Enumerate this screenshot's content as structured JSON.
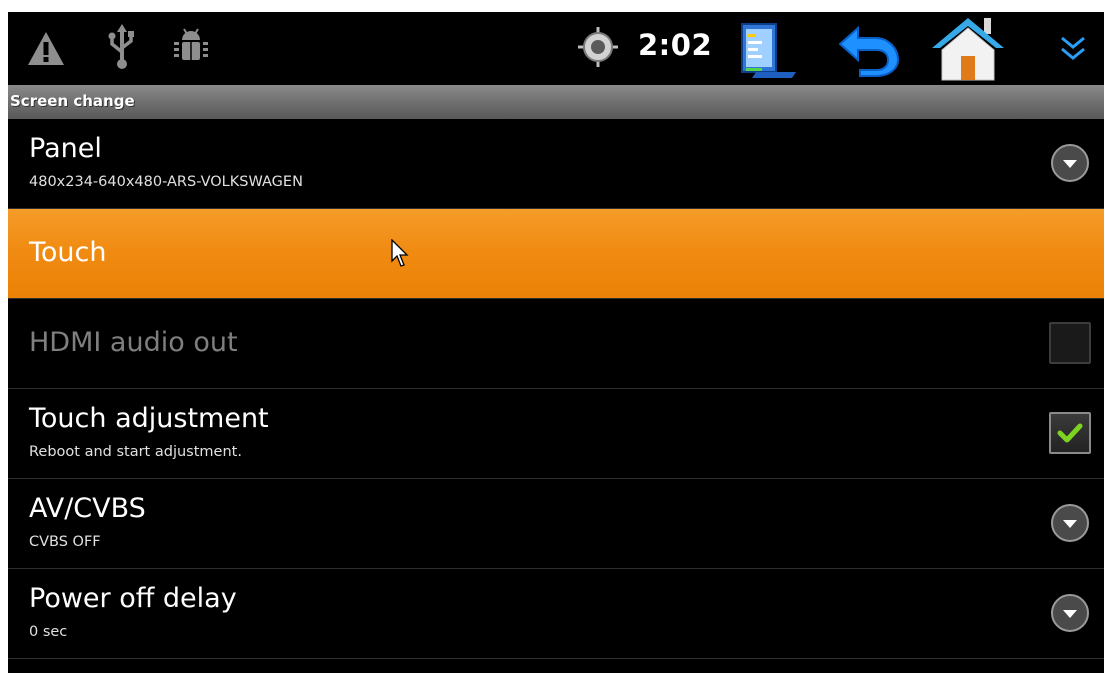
{
  "status_bar": {
    "time": "2:02",
    "icons": [
      "warning-icon",
      "usb-icon",
      "android-debug-icon",
      "gps-icon",
      "app-window-icon",
      "back-icon",
      "home-icon",
      "expand-icon"
    ]
  },
  "title_bar": {
    "title": "Screen change"
  },
  "settings": [
    {
      "title": "Panel",
      "subtitle": "480x234-640x480-ARS-VOLKSWAGEN",
      "control": "dropdown"
    },
    {
      "title": "Touch",
      "subtitle": "",
      "control": "none",
      "selected": true
    },
    {
      "title": "HDMI audio out",
      "subtitle": "",
      "control": "checkbox",
      "checked": false,
      "disabled": true
    },
    {
      "title": "Touch adjustment",
      "subtitle": "Reboot and start adjustment.",
      "control": "checkbox",
      "checked": true
    },
    {
      "title": "AV/CVBS",
      "subtitle": "CVBS OFF",
      "control": "dropdown"
    },
    {
      "title": "Power off delay",
      "subtitle": "0 sec",
      "control": "dropdown"
    }
  ],
  "colors": {
    "selected_row": "#f08a10",
    "check_mark": "#7ed321",
    "background": "#000000",
    "title_bar": "#6d6d6d",
    "disabled_text": "#7f7f7f"
  }
}
